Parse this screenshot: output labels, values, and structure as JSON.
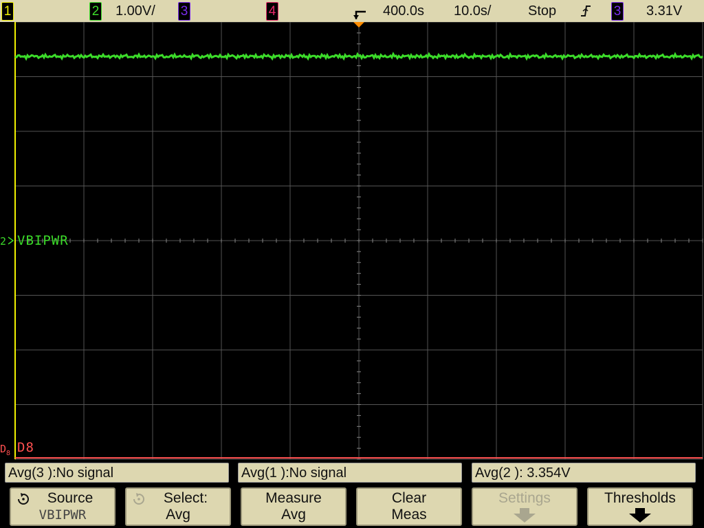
{
  "topbar": {
    "ch1": "1",
    "ch2": "2",
    "ch2_scale": "1.00V/",
    "ch3": "3",
    "ch4": "4",
    "trigger_icon": "trigger-marker-icon",
    "delay": "400.0s",
    "timebase": "10.0s/",
    "run_state": "Stop",
    "trigger_slope_icon": "rising-edge-icon",
    "trigger_source": "3",
    "trigger_level": "3.31V"
  },
  "screen": {
    "ch2_marker": "2",
    "ch2_label": "VBIPWR",
    "digital_marker": "D",
    "digital_sub": "8",
    "digital_label": "D8"
  },
  "measurements": [
    {
      "label": "Avg(3 ):No signal"
    },
    {
      "label": "Avg(1 ):No signal"
    },
    {
      "label": "Avg(2 ): 3.354V"
    }
  ],
  "softkeys": [
    {
      "top": "Source",
      "bottom": "VBIPWR",
      "icon": "rotate-knob-icon"
    },
    {
      "top": "Select:",
      "bottom": "Avg",
      "icon": "rotate-knob-icon"
    },
    {
      "top": "Measure",
      "bottom": "Avg"
    },
    {
      "top": "Clear",
      "bottom": "Meas"
    },
    {
      "top": "Settings",
      "icon": "down-arrow-icon"
    },
    {
      "top": "Thresholds",
      "icon": "down-arrow-icon"
    }
  ],
  "colors": {
    "ch1": "#f2f200",
    "ch2": "#3cdc2a",
    "ch3": "#7a2cf0",
    "ch4": "#e8286a",
    "digital": "#ff5050",
    "grid": "#555555",
    "panel": "#ddd7b0",
    "trigger_marker": "#ff8c00"
  }
}
